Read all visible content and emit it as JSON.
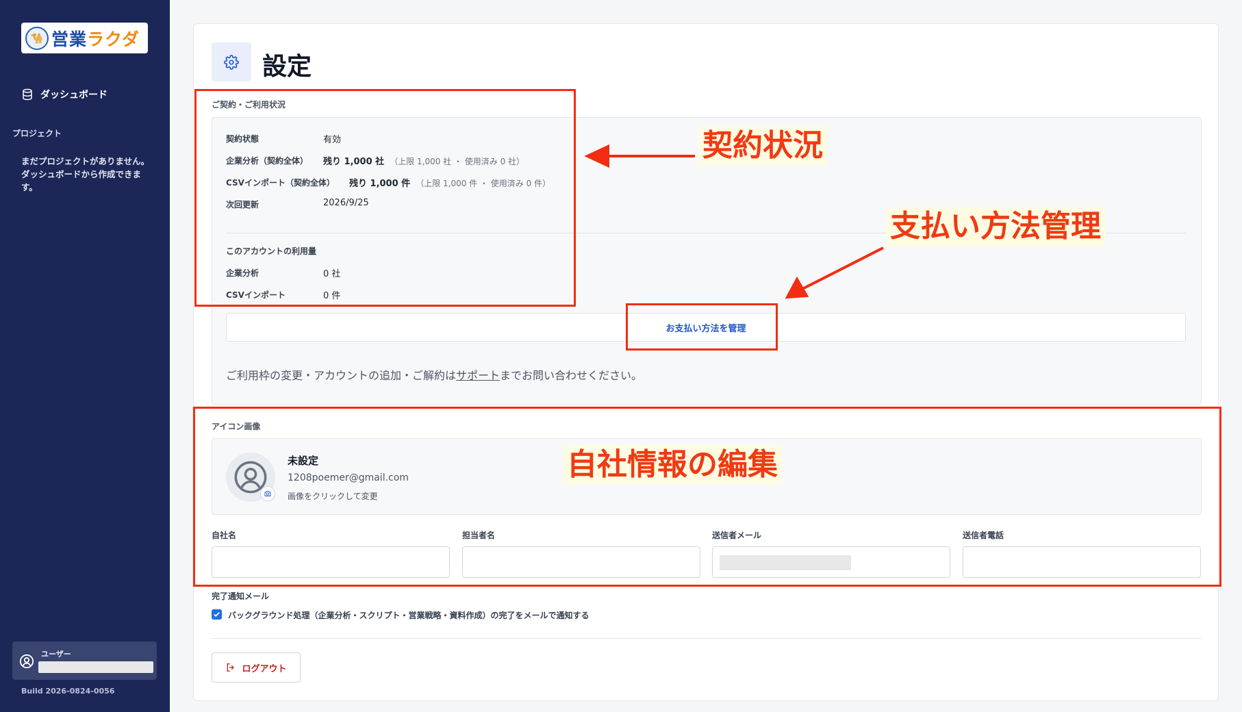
{
  "sidebar": {
    "logo": {
      "part1": "営業",
      "part2": "ラクダ",
      "mark": "🐪"
    },
    "dashboard_label": "ダッシュボード",
    "project_section": "プロジェクト",
    "empty_message": "まだプロジェクトがありません。ダッシュボードから作成できます。",
    "user_label": "ユーザー",
    "build": "Build 2026-0824-0056"
  },
  "page": {
    "title": "設定"
  },
  "contract": {
    "section_label": "ご契約・ご利用状況",
    "rows": [
      {
        "label": "契約状態",
        "value": "有効",
        "sub": ""
      },
      {
        "label": "企業分析（契約全体）",
        "value": "残り 1,000 社",
        "sub": "（上限 1,000 社 ・ 使用済み 0 社）"
      },
      {
        "label": "CSVインポート（契約全体）",
        "value": "残り 1,000 件",
        "sub": "（上限 1,000 件 ・ 使用済み 0 件）"
      },
      {
        "label": "次回更新",
        "value": "2026/9/25",
        "sub": ""
      }
    ],
    "account_usage_label": "このアカウントの利用量",
    "usage_rows": [
      {
        "label": "企業分析",
        "value": "0 社"
      },
      {
        "label": "CSVインポート",
        "value": "0 件"
      }
    ],
    "manage_payment_button": "お支払い方法を管理",
    "notice_before": "ご利用枠の変更・アカウントの追加・ご解約は",
    "notice_link": "サポート",
    "notice_after": "までお問い合わせください。"
  },
  "icon_section": {
    "label": "アイコン画像",
    "name": "未設定",
    "email": "1208poemer@gmail.com",
    "hint": "画像をクリックして変更"
  },
  "fields": [
    {
      "label": "自社名"
    },
    {
      "label": "担当者名"
    },
    {
      "label": "送信者メール"
    },
    {
      "label": "送信者電話"
    }
  ],
  "notify": {
    "label": "完了通知メール",
    "checkbox_text": "バックグラウンド処理（企業分析・スクリプト・営業戦略・資料作成）の完了をメールで通知する",
    "checked": true
  },
  "logout_button": "ログアウト",
  "annotations": {
    "contract_status": "契約状況",
    "payment_management": "支払い方法管理",
    "company_info": "自社情報の編集",
    "color": "#f22d12"
  }
}
